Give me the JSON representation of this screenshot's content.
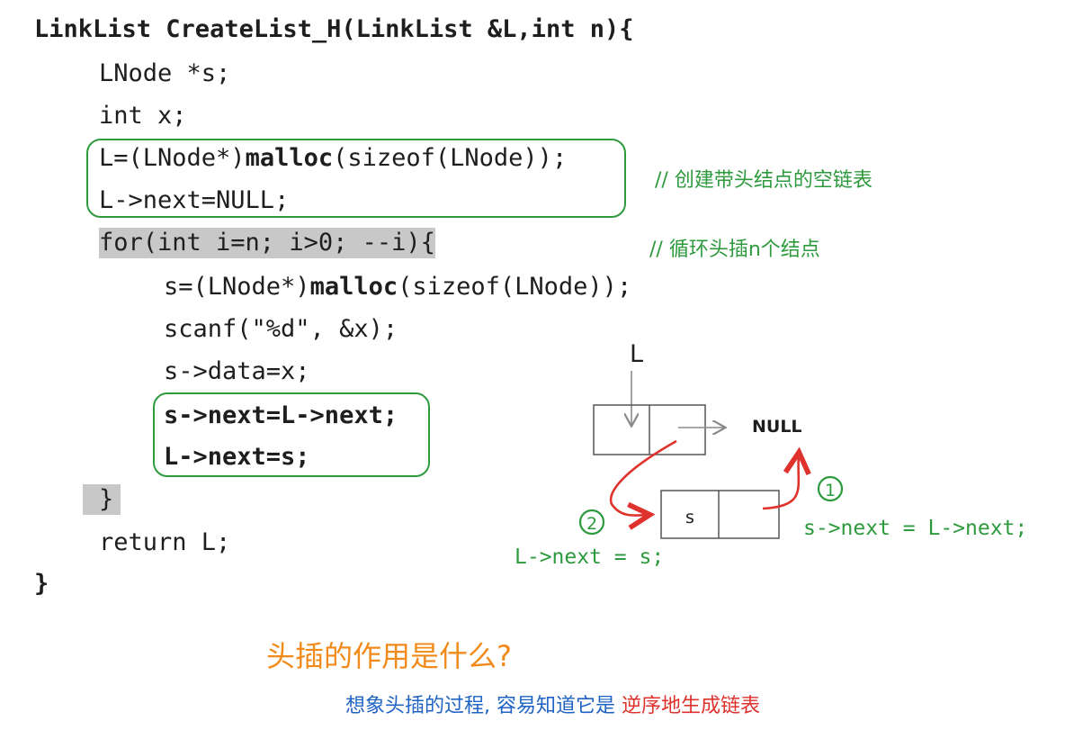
{
  "code": {
    "line1": "LinkList CreateList_H(LinkList &L,int n){",
    "line2": "LNode *s;",
    "line3": "int x;",
    "line4_a": "L=(LNode*)",
    "line4_b": "malloc",
    "line4_c": "(sizeof(LNode));",
    "line5": "L->next=NULL;",
    "line6": "for(int i=n; i>0; --i){",
    "line7_a": "s=(LNode*)",
    "line7_b": "malloc",
    "line7_c": "(sizeof(LNode));",
    "line8": "scanf(\"%d\", &x);",
    "line9": "s->data=x;",
    "line10": "s->next=L->next;",
    "line11": "L->next=s;",
    "line12": "}",
    "line13": "return L;",
    "line14": "}"
  },
  "comments": {
    "c1": "// 创建带头结点的空链表",
    "c2": "// 循环头插n个结点"
  },
  "diagram": {
    "head_label": "L",
    "null_label": "NULL",
    "new_node_label": "s",
    "step1_marker": "1",
    "step2_marker": "2",
    "step1_text": "s->next = L->next;",
    "step2_text": "L->next = s;"
  },
  "question": "头插的作用是什么?",
  "answer": {
    "part1": "想象头插的过程, 容易知道它是 ",
    "part2": "逆序地生成链表"
  },
  "colors": {
    "green": "#2e9a3e",
    "red": "#e0322d",
    "orange": "#f28a1a",
    "blue": "#1f63c4"
  }
}
